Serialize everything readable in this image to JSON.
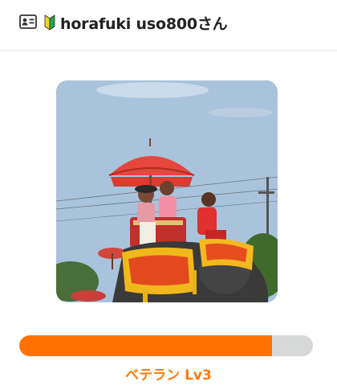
{
  "header": {
    "username": "horafuki uso800さん",
    "profile_icon": "id-card-icon",
    "badge_icon": "beginner-mark-icon"
  },
  "photo": {
    "alt": "Profile photo"
  },
  "level": {
    "rank_label": "ベテラン Lv3",
    "progress_fraction": 0.86
  },
  "colors": {
    "accent": "#ff7200",
    "track": "#d6d9d8",
    "label": "#ff7a0a",
    "beginner_green": "#1fa84a",
    "beginner_yellow": "#f2d21b"
  }
}
